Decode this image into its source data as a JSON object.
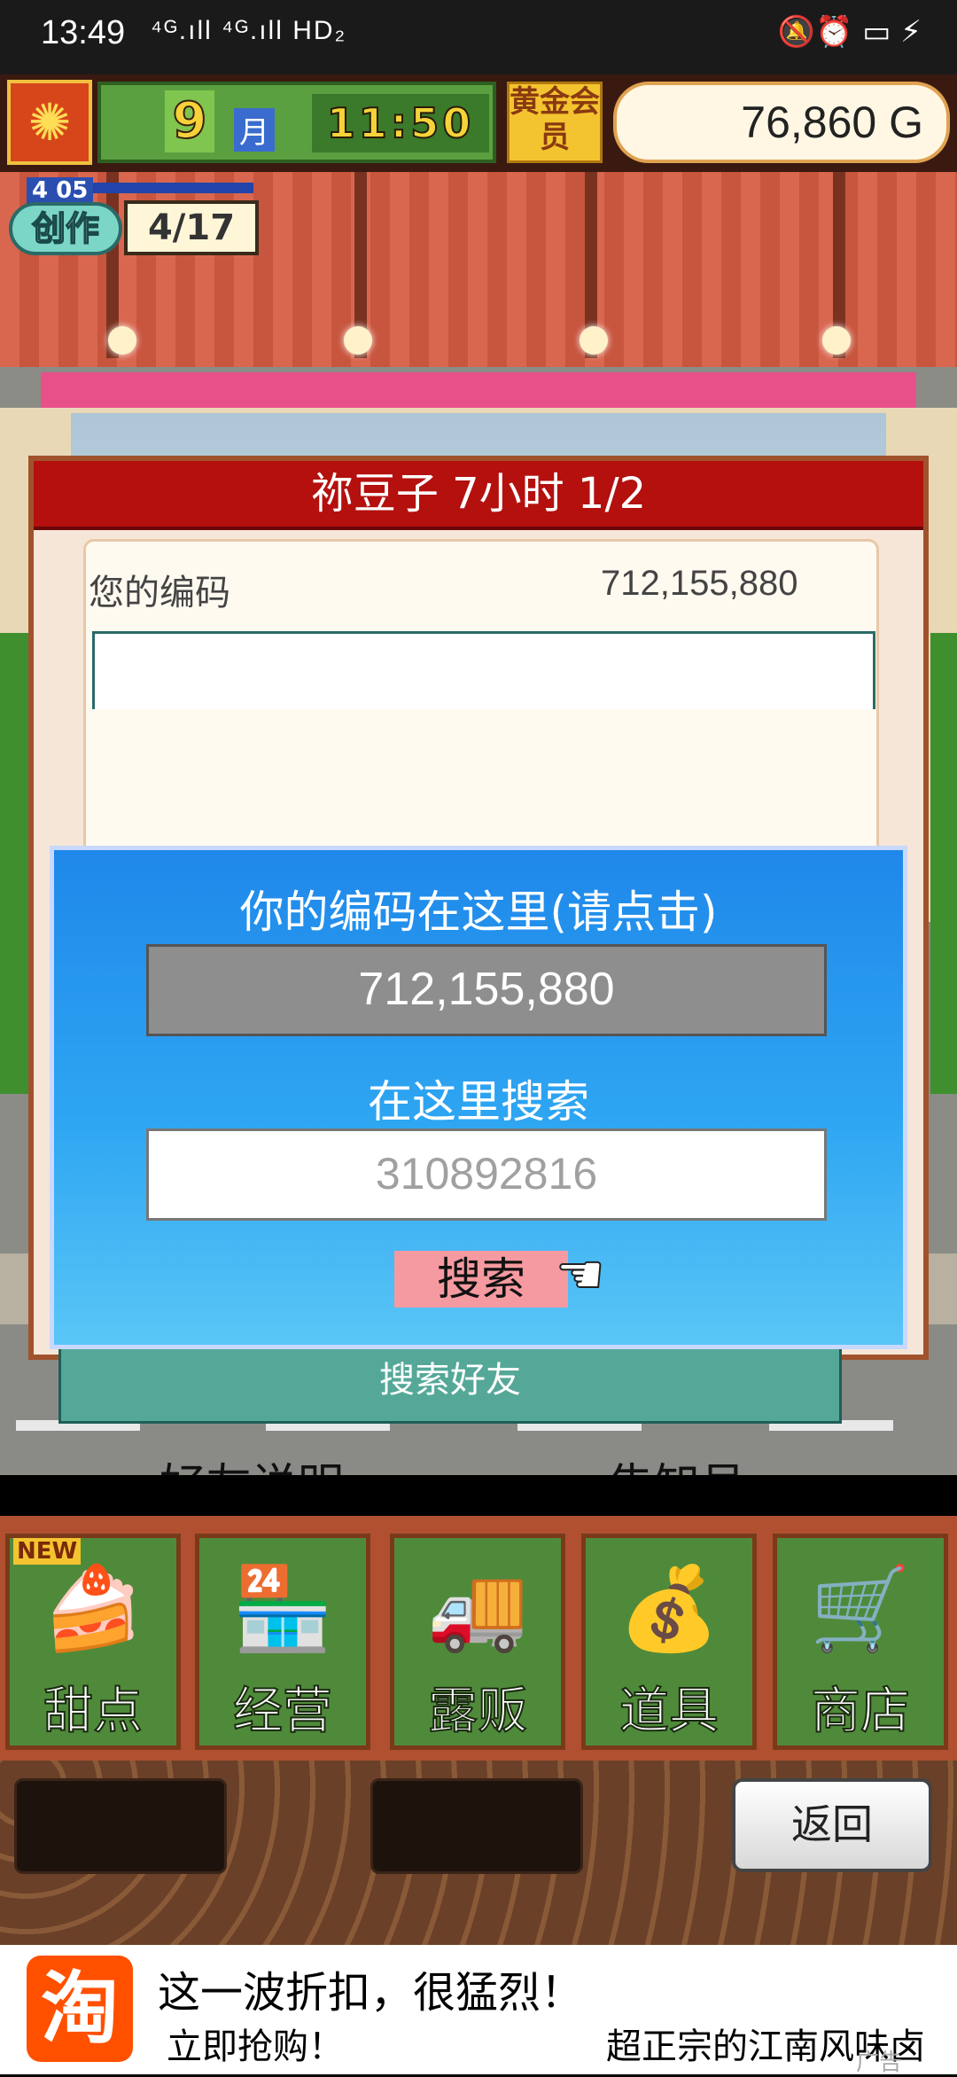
{
  "status_bar": {
    "time": "13:49",
    "network": "⁴ᴳ.ıll ⁴ᴳ.ıll HD₂",
    "right_icons": "🔕⏰ ▭ ⚡"
  },
  "hud": {
    "month_number": "9",
    "month_label": "月",
    "clock": "11:50",
    "gold_member": "黄金会员",
    "money": "76,860 G",
    "workshop": {
      "tag": "4 05",
      "label": "创作",
      "count": "4/17"
    }
  },
  "panel": {
    "title": "祢豆子  7小时 1/2",
    "code_label": "您的编码",
    "code_value": "712,155,880",
    "search_friend_label": "搜索好友",
    "help_label": "好友说明",
    "notice_label": "告知号"
  },
  "dialog": {
    "title": "你的编码在这里(请点击)",
    "code": "712,155,880",
    "search_label": "在这里搜索",
    "input_placeholder": "310892816",
    "search_button": "搜索"
  },
  "menu": {
    "items": [
      {
        "label": "甜点",
        "badge": "NEW",
        "icon": "cake-icon"
      },
      {
        "label": "经营",
        "icon": "shop-icon"
      },
      {
        "label": "露贩",
        "icon": "food-truck-icon"
      },
      {
        "label": "道具",
        "icon": "item-bag-icon"
      },
      {
        "label": "商店",
        "icon": "cart-icon"
      }
    ],
    "back_label": "返回"
  },
  "ad": {
    "logo": "淘",
    "line1": "这一波折扣，很猛烈！",
    "line2": "立即抢购！",
    "line3": "超正宗的江南风味卤",
    "tag": "广告"
  },
  "colors": {
    "panel_title": "#b3100e",
    "dialog_top": "#1f88ea",
    "search_button": "#f59aa0",
    "menu_tile": "#4f8a3a"
  }
}
